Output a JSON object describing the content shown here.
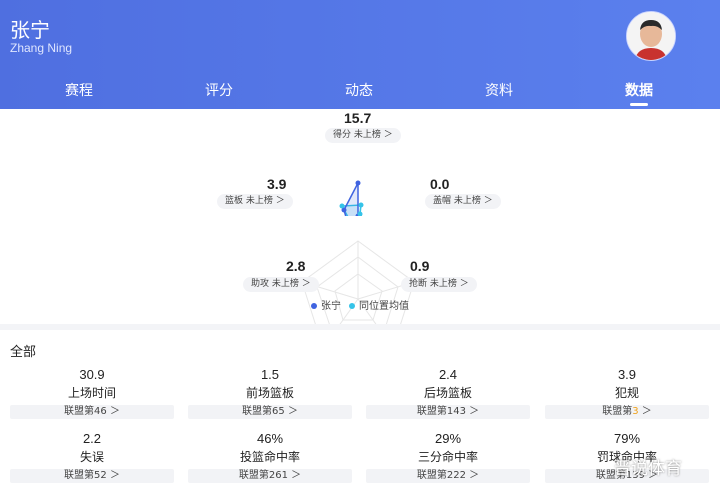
{
  "player": {
    "name": "张宁",
    "english_name": "Zhang Ning"
  },
  "tabs": [
    {
      "label": "赛程"
    },
    {
      "label": "评分"
    },
    {
      "label": "动态"
    },
    {
      "label": "资料"
    },
    {
      "label": "数据",
      "active": true
    }
  ],
  "radar": {
    "top": {
      "value": "15.7",
      "label": "得分 未上榜 ＞"
    },
    "right": {
      "value": "0.0",
      "label": "盖帽 未上榜 ＞"
    },
    "bottom_right": {
      "value": "0.9",
      "label": "抢断 未上榜 ＞"
    },
    "bottom_left": {
      "value": "2.8",
      "label": "助攻 未上榜 ＞"
    },
    "left": {
      "value": "3.9",
      "label": "篮板 未上榜 ＞"
    },
    "legend": [
      {
        "label": "张宁",
        "color": "#3f63e0"
      },
      {
        "label": "同位置均值",
        "color": "#35c3e8"
      }
    ]
  },
  "section_title": "全部",
  "stats": [
    {
      "value": "30.9",
      "label": "上场时间",
      "rank_prefix": "联盟第",
      "rank": "46",
      "rank_suffix": " ＞"
    },
    {
      "value": "1.5",
      "label": "前场篮板",
      "rank_prefix": "联盟第",
      "rank": "65",
      "rank_suffix": " ＞"
    },
    {
      "value": "2.4",
      "label": "后场篮板",
      "rank_prefix": "联盟第",
      "rank": "143",
      "rank_suffix": " ＞"
    },
    {
      "value": "3.9",
      "label": "犯规",
      "rank_prefix": "联盟第",
      "rank": "3",
      "rank_suffix": " ＞",
      "highlight": true
    },
    {
      "value": "2.2",
      "label": "失误",
      "rank_prefix": "联盟第",
      "rank": "52",
      "rank_suffix": " ＞"
    },
    {
      "value": "46%",
      "label": "投篮命中率",
      "rank_prefix": "联盟第",
      "rank": "261",
      "rank_suffix": " ＞"
    },
    {
      "value": "29%",
      "label": "三分命中率",
      "rank_prefix": "联盟第",
      "rank": "222",
      "rank_suffix": " ＞"
    },
    {
      "value": "79%",
      "label": "罚球命中率",
      "rank_prefix": "联盟第",
      "rank": "139",
      "rank_suffix": " ＞"
    }
  ],
  "watermark": "晋说体育"
}
